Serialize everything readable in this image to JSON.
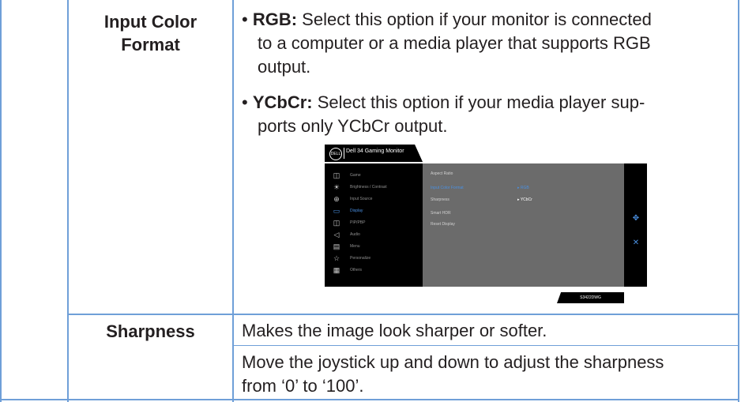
{
  "rows": [
    {
      "parameter_line1": "Input Color",
      "parameter_line2": "Format",
      "bullets": [
        {
          "term": "RGB:",
          "lines": [
            "Select this option if your monitor is connected",
            "to a computer or a media player that supports RGB",
            "output."
          ]
        },
        {
          "term": "YCbCr:",
          "lines": [
            "Select this option if your media player sup-",
            "ports only YCbCr output."
          ]
        }
      ]
    },
    {
      "parameter": "Sharpness",
      "desc1": "Makes the image look sharper or softer.",
      "desc2_line1": "Move the joystick up and down to adjust the sharpness",
      "desc2_line2": "from ‘0’ to ‘100’."
    }
  ],
  "osd": {
    "logo": "DELL",
    "title": "Dell 34 Gaming Monitor",
    "menu": [
      {
        "icon": "game-icon",
        "label": "Game"
      },
      {
        "icon": "brightness-icon",
        "label": "Brightness / Contrast"
      },
      {
        "icon": "input-source-icon",
        "label": "Input Source"
      },
      {
        "icon": "display-icon",
        "label": "Display"
      },
      {
        "icon": "pip-pbp-icon",
        "label": "PIP/PBP"
      },
      {
        "icon": "audio-icon",
        "label": "Audio"
      },
      {
        "icon": "menu-icon",
        "label": "Menu"
      },
      {
        "icon": "personalize-icon",
        "label": "Personalize"
      },
      {
        "icon": "others-icon",
        "label": "Others"
      }
    ],
    "active_menu": "Display",
    "content": [
      "Aspect Ratio",
      "Input Color Format",
      "Sharpness",
      "Smart HDR",
      "Reset Display"
    ],
    "active_content": "Input Color Format",
    "options": [
      "RGB",
      "YCbCr"
    ],
    "model": "S3422DWG",
    "colors": {
      "accent": "#4a90e2",
      "panel": "#6b6b6b",
      "frame": "#000000"
    }
  }
}
